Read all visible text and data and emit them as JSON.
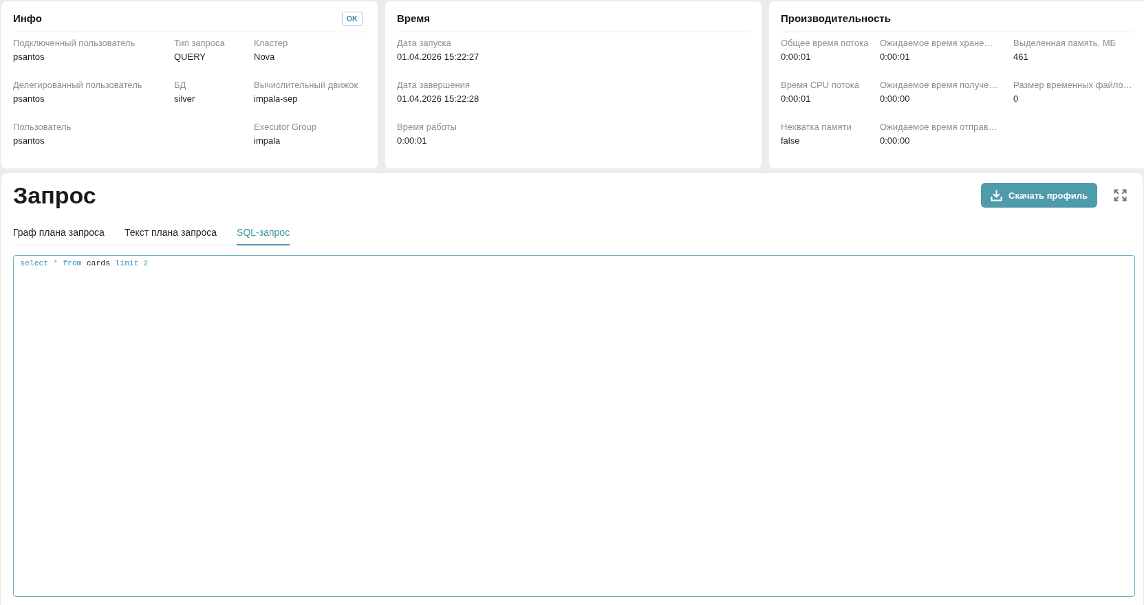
{
  "info": {
    "title": "Инфо",
    "status": "OK",
    "columns": [
      [
        {
          "label": "Подключенный пользователь",
          "value": "psantos"
        },
        {
          "label": "Делегированный пользователь",
          "value": "psantos"
        },
        {
          "label": "Пользователь",
          "value": "psantos"
        }
      ],
      [
        {
          "label": "Тип запроса",
          "value": "QUERY"
        },
        {
          "label": "БД",
          "value": "silver"
        }
      ],
      [
        {
          "label": "Кластер",
          "value": "Nova"
        },
        {
          "label": "Вычислительный движок",
          "value": "impala-sep"
        },
        {
          "label": "Executor Group",
          "value": "impala"
        }
      ]
    ]
  },
  "time": {
    "title": "Время",
    "columns": [
      [
        {
          "label": "Дата запуска",
          "value": "01.04.2026 15:22:27"
        },
        {
          "label": "Дата завершения",
          "value": "01.04.2026 15:22:28"
        },
        {
          "label": "Время работы",
          "value": "0:00:01"
        }
      ]
    ]
  },
  "performance": {
    "title": "Производительность",
    "columns": [
      [
        {
          "label": "Общее время потока",
          "value": "0:00:01"
        },
        {
          "label": "Время CPU потока",
          "value": "0:00:01"
        },
        {
          "label": "Нехватка памяти",
          "value": "false"
        }
      ],
      [
        {
          "label": "Ожидаемое время хране…",
          "value": "0:00:01"
        },
        {
          "label": "Ожидаемое время получе…",
          "value": "0:00:00"
        },
        {
          "label": "Ожидаемое время отправ…",
          "value": "0:00:00"
        }
      ],
      [
        {
          "label": "Выделенная память, МБ",
          "value": "461"
        },
        {
          "label": "Размер временных файло…",
          "value": "0"
        }
      ]
    ]
  },
  "query": {
    "title": "Запрос",
    "download_button": "Скачать профиль",
    "tabs": [
      {
        "label": "Граф плана запроса",
        "selected": false
      },
      {
        "label": "Текст плана запроса",
        "selected": false
      },
      {
        "label": "SQL-запрос",
        "selected": true
      }
    ],
    "sql": {
      "tokens": [
        {
          "text": "select",
          "kind": "keyword"
        },
        {
          "text": "*",
          "kind": "operator"
        },
        {
          "text": "from",
          "kind": "keyword"
        },
        {
          "text": "cards",
          "kind": "identifier"
        },
        {
          "text": "limit",
          "kind": "keyword"
        },
        {
          "text": "2",
          "kind": "number"
        }
      ]
    }
  }
}
